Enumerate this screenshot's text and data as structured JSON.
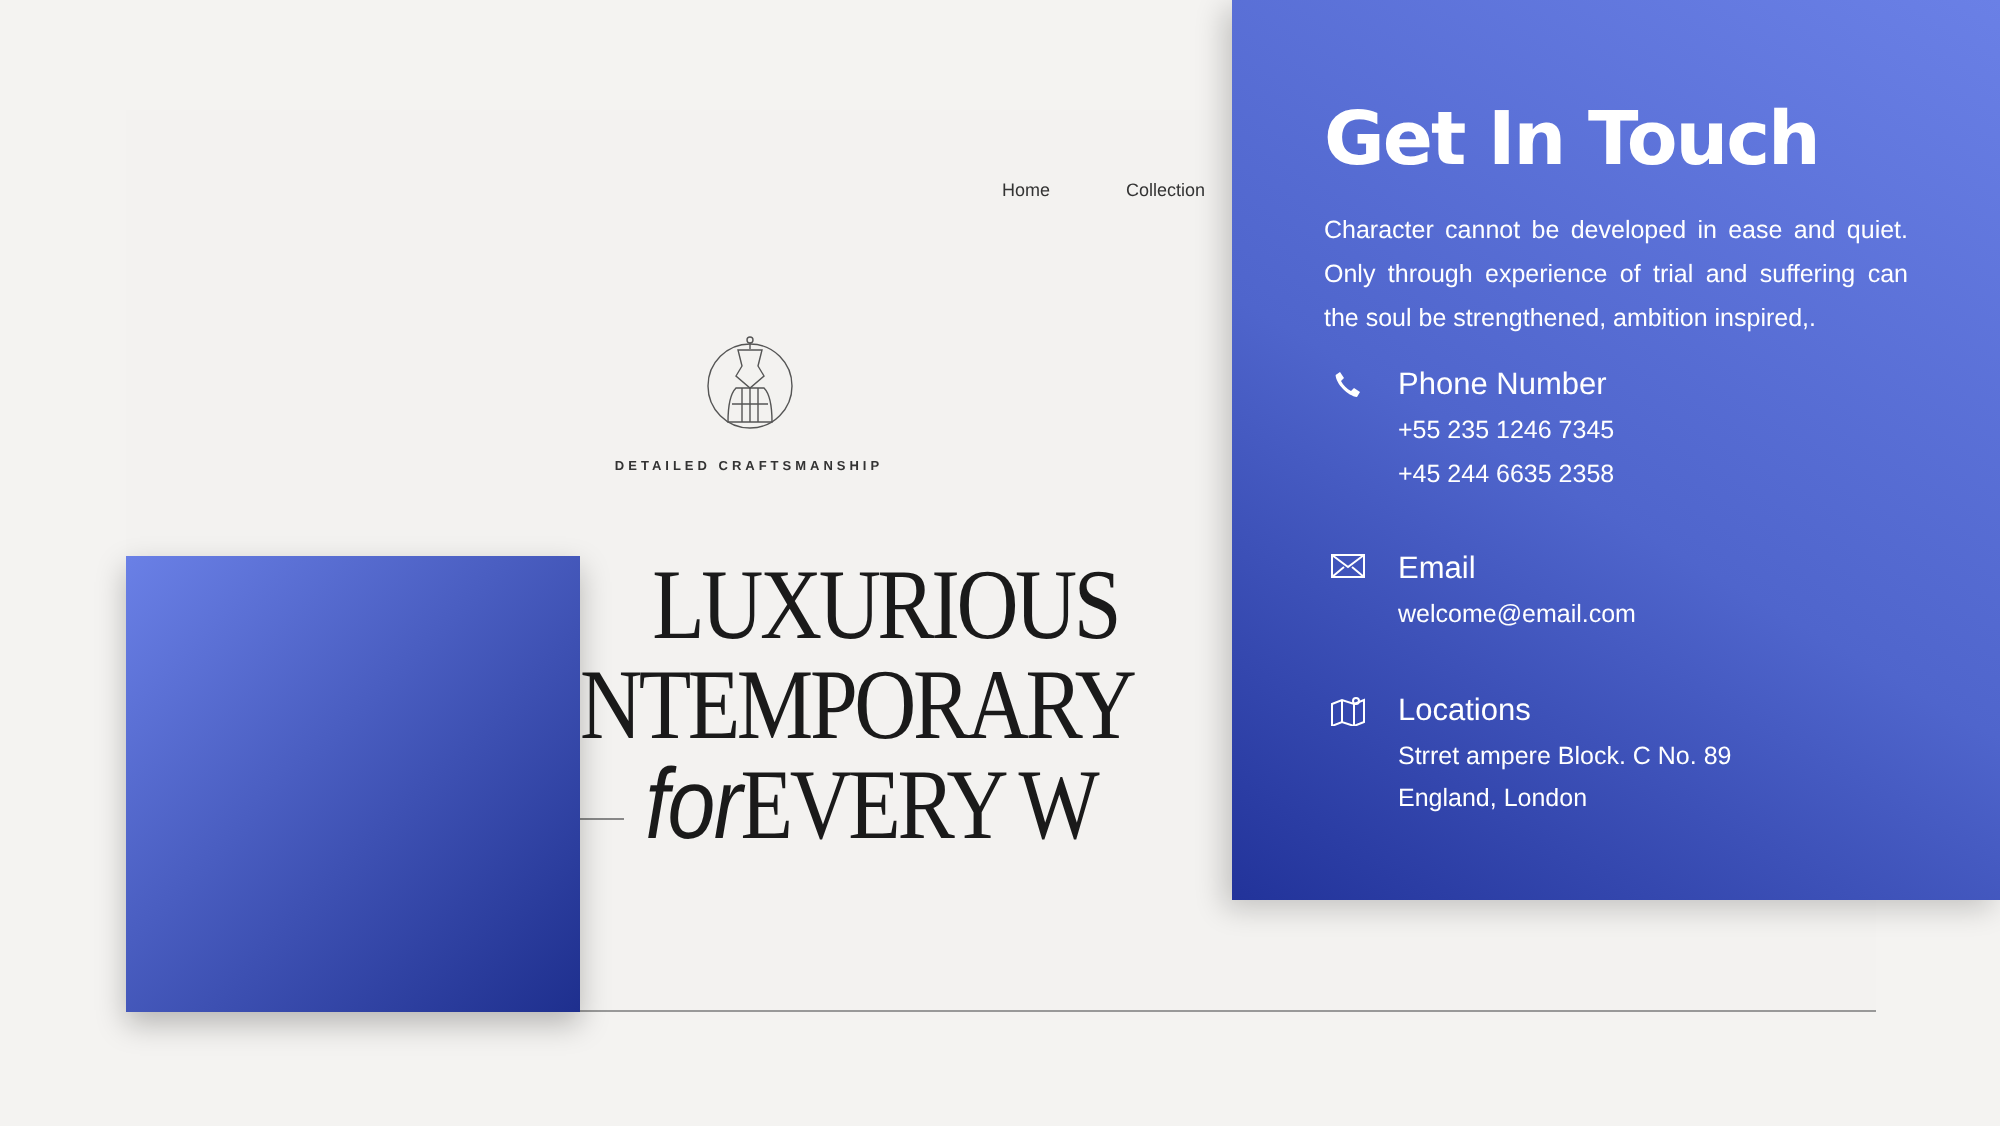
{
  "nav": {
    "items": [
      {
        "label": "Home"
      },
      {
        "label": "Collection"
      }
    ]
  },
  "hero": {
    "tagline": "DETAILED CRAFTSMANSHIP",
    "headline": [
      {
        "text": "LUXURIOUS",
        "italic": false
      },
      {
        "text": "NTEMPORARY",
        "italic": false
      },
      {
        "text": "for",
        "italic": true,
        "rest": "EVERY W"
      }
    ]
  },
  "contact": {
    "title": "Get In Touch",
    "body": "Character cannot be developed in ease and quiet. Only through experience of trial and suffering can the soul be strengthened, ambition inspired,.",
    "items": [
      {
        "kind": "phone",
        "heading": "Phone Number",
        "lines": [
          "+55 235 1246 7345",
          "+45 244 6635 2358"
        ]
      },
      {
        "kind": "email",
        "heading": "Email",
        "lines": [
          "welcome@email.com"
        ]
      },
      {
        "kind": "location",
        "heading": "Locations",
        "lines": [
          "Strret ampere Block. C No. 89",
          "England, London"
        ]
      }
    ]
  }
}
